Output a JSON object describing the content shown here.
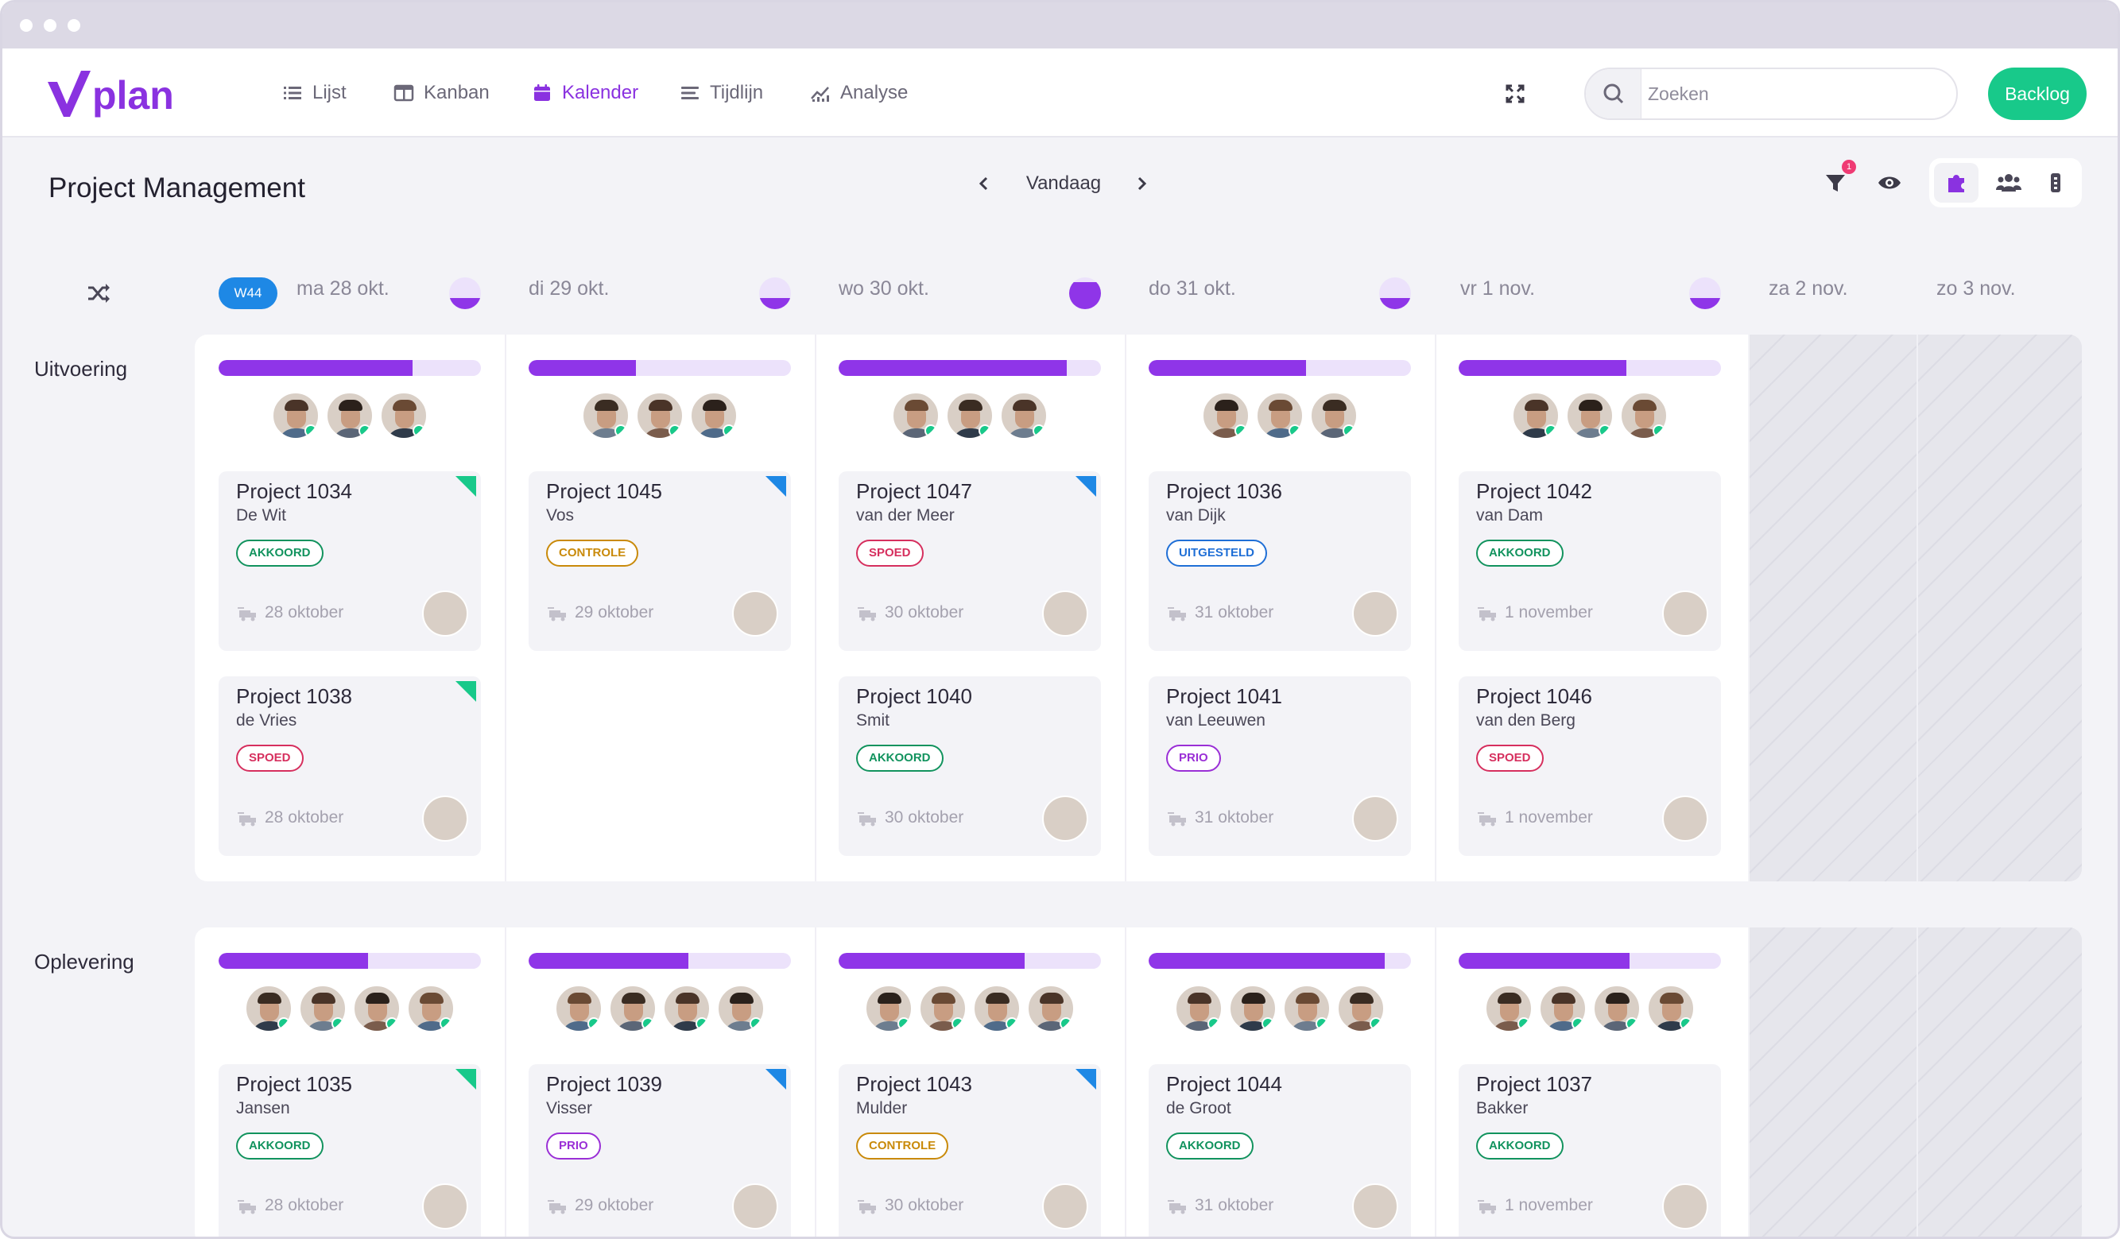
{
  "nav": {
    "items": [
      {
        "label": "Lijst",
        "icon": "list-icon"
      },
      {
        "label": "Kanban",
        "icon": "kanban-icon"
      },
      {
        "label": "Kalender",
        "icon": "calendar-icon",
        "active": true
      },
      {
        "label": "Tijdlijn",
        "icon": "timeline-icon"
      },
      {
        "label": "Analyse",
        "icon": "chart-icon"
      }
    ],
    "search_placeholder": "Zoeken",
    "backlog_label": "Backlog",
    "accent_color": "#8a32e0",
    "backlog_color": "#18c98a"
  },
  "header": {
    "title": "Project Management",
    "today_label": "Vandaag",
    "filter_count": "1"
  },
  "calendar": {
    "week_badge": "W44",
    "days": [
      "ma 28 okt.",
      "di 29 okt.",
      "wo 30 okt.",
      "do 31 okt.",
      "vr 1 nov.",
      "za 2 nov.",
      "zo 3 nov."
    ],
    "day_load": [
      0.35,
      0.35,
      0.85,
      0.35,
      0.35
    ]
  },
  "groups": [
    {
      "label": "Uitvoering",
      "capacity": [
        0.74,
        0.41,
        0.87,
        0.6,
        0.64
      ],
      "team_sizes": [
        3,
        3,
        3,
        3,
        3
      ],
      "cards": [
        [
          {
            "title": "Project 1034",
            "client": "De Wit",
            "status": "AKKOORD",
            "status_color": "green",
            "tag": "#18c98a",
            "date": "28 oktober"
          },
          {
            "title": "Project 1038",
            "client": "de Vries",
            "status": "SPOED",
            "status_color": "red",
            "tag": "#18c98a",
            "date": "28 oktober"
          }
        ],
        [
          {
            "title": "Project 1045",
            "client": "Vos",
            "status": "CONTROLE",
            "status_color": "yellow",
            "tag": "#1e88e5",
            "date": "29 oktober"
          }
        ],
        [
          {
            "title": "Project 1047",
            "client": "van der Meer",
            "status": "SPOED",
            "status_color": "red",
            "tag": "#1e88e5",
            "date": "30 oktober"
          },
          {
            "title": "Project 1040",
            "client": "Smit",
            "status": "AKKOORD",
            "status_color": "green",
            "tag": "",
            "date": "30 oktober"
          }
        ],
        [
          {
            "title": "Project 1036",
            "client": "van Dijk",
            "status": "UITGESTELD",
            "status_color": "blue",
            "tag": "",
            "date": "31 oktober"
          },
          {
            "title": "Project 1041",
            "client": "van Leeuwen",
            "status": "PRIO",
            "status_color": "purple",
            "tag": "",
            "date": "31 oktober"
          }
        ],
        [
          {
            "title": "Project 1042",
            "client": "van Dam",
            "status": "AKKOORD",
            "status_color": "green",
            "tag": "",
            "date": "1 november"
          },
          {
            "title": "Project 1046",
            "client": "van den Berg",
            "status": "SPOED",
            "status_color": "red",
            "tag": "",
            "date": "1 november"
          }
        ]
      ]
    },
    {
      "label": "Oplevering",
      "capacity": [
        0.57,
        0.61,
        0.71,
        0.9,
        0.65
      ],
      "team_sizes": [
        4,
        4,
        4,
        4,
        4
      ],
      "cards": [
        [
          {
            "title": "Project 1035",
            "client": "Jansen",
            "status": "AKKOORD",
            "status_color": "green",
            "tag": "#18c98a",
            "date": "28 oktober"
          }
        ],
        [
          {
            "title": "Project 1039",
            "client": "Visser",
            "status": "PRIO",
            "status_color": "purple",
            "tag": "#1e88e5",
            "date": "29 oktober"
          }
        ],
        [
          {
            "title": "Project 1043",
            "client": "Mulder",
            "status": "CONTROLE",
            "status_color": "yellow",
            "tag": "#1e88e5",
            "date": "30 oktober"
          }
        ],
        [
          {
            "title": "Project 1044",
            "client": "de Groot",
            "status": "AKKOORD",
            "status_color": "green",
            "tag": "",
            "date": "31 oktober"
          }
        ],
        [
          {
            "title": "Project 1037",
            "client": "Bakker",
            "status": "AKKOORD",
            "status_color": "green",
            "tag": "",
            "date": "1 november"
          }
        ]
      ]
    }
  ]
}
